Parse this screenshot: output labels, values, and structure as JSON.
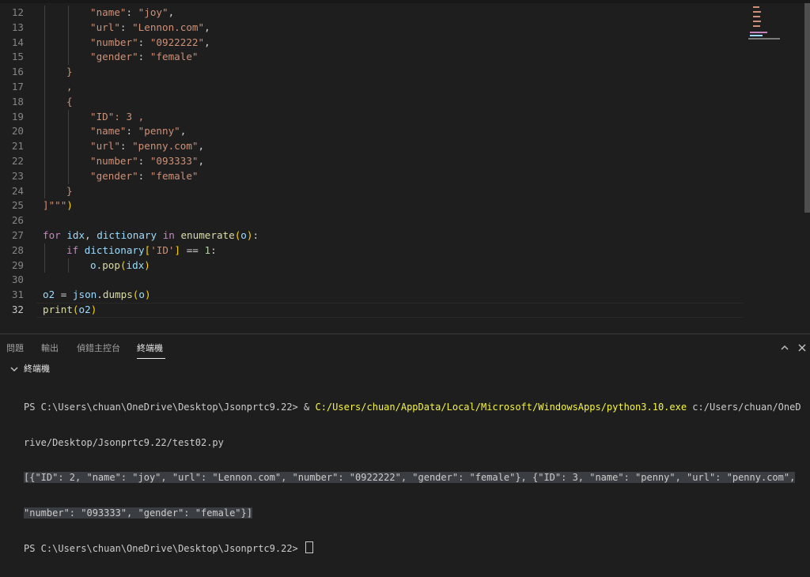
{
  "editor": {
    "lines": [
      {
        "n": "12",
        "indent": 2,
        "tokens": [
          {
            "t": "\"name\"",
            "c": "str"
          },
          {
            "t": ": ",
            "c": "p"
          },
          {
            "t": "\"joy\"",
            "c": "str"
          },
          {
            "t": ",",
            "c": "p"
          }
        ]
      },
      {
        "n": "13",
        "indent": 2,
        "tokens": [
          {
            "t": "\"url\"",
            "c": "str"
          },
          {
            "t": ": ",
            "c": "p"
          },
          {
            "t": "\"Lennon.com\"",
            "c": "str"
          },
          {
            "t": ",",
            "c": "p"
          }
        ]
      },
      {
        "n": "14",
        "indent": 2,
        "tokens": [
          {
            "t": "\"number\"",
            "c": "str"
          },
          {
            "t": ": ",
            "c": "p"
          },
          {
            "t": "\"0922222\"",
            "c": "str"
          },
          {
            "t": ",",
            "c": "p"
          }
        ]
      },
      {
        "n": "15",
        "indent": 2,
        "tokens": [
          {
            "t": "\"gender\"",
            "c": "str"
          },
          {
            "t": ": ",
            "c": "p"
          },
          {
            "t": "\"female\"",
            "c": "str"
          }
        ]
      },
      {
        "n": "16",
        "indent": 1,
        "tokens": [
          {
            "t": "}",
            "c": "str"
          }
        ]
      },
      {
        "n": "17",
        "indent": 1,
        "tokens": [
          {
            "t": ",",
            "c": "str"
          }
        ]
      },
      {
        "n": "18",
        "indent": 1,
        "tokens": [
          {
            "t": "{",
            "c": "str"
          }
        ]
      },
      {
        "n": "19",
        "indent": 2,
        "tokens": [
          {
            "t": "\"ID\"",
            "c": "str"
          },
          {
            "t": ": 3 ,",
            "c": "str"
          }
        ]
      },
      {
        "n": "20",
        "indent": 2,
        "tokens": [
          {
            "t": "\"name\"",
            "c": "str"
          },
          {
            "t": ": ",
            "c": "p"
          },
          {
            "t": "\"penny\"",
            "c": "str"
          },
          {
            "t": ",",
            "c": "p"
          }
        ]
      },
      {
        "n": "21",
        "indent": 2,
        "tokens": [
          {
            "t": "\"url\"",
            "c": "str"
          },
          {
            "t": ": ",
            "c": "p"
          },
          {
            "t": "\"penny.com\"",
            "c": "str"
          },
          {
            "t": ",",
            "c": "p"
          }
        ]
      },
      {
        "n": "22",
        "indent": 2,
        "tokens": [
          {
            "t": "\"number\"",
            "c": "str"
          },
          {
            "t": ": ",
            "c": "p"
          },
          {
            "t": "\"093333\"",
            "c": "str"
          },
          {
            "t": ",",
            "c": "p"
          }
        ]
      },
      {
        "n": "23",
        "indent": 2,
        "tokens": [
          {
            "t": "\"gender\"",
            "c": "str"
          },
          {
            "t": ": ",
            "c": "p"
          },
          {
            "t": "\"female\"",
            "c": "str"
          }
        ]
      },
      {
        "n": "24",
        "indent": 1,
        "tokens": [
          {
            "t": "}",
            "c": "str"
          }
        ]
      },
      {
        "n": "25",
        "indent": 0,
        "tokens": [
          {
            "t": "]\"\"\"",
            "c": "str"
          },
          {
            "t": ")",
            "c": "br1"
          }
        ]
      },
      {
        "n": "26",
        "indent": 0,
        "tokens": []
      },
      {
        "n": "27",
        "indent": 0,
        "tokens": [
          {
            "t": "for",
            "c": "kw"
          },
          {
            "t": " ",
            "c": "p"
          },
          {
            "t": "idx",
            "c": "var"
          },
          {
            "t": ", ",
            "c": "p"
          },
          {
            "t": "dictionary",
            "c": "var"
          },
          {
            "t": " ",
            "c": "p"
          },
          {
            "t": "in",
            "c": "kw"
          },
          {
            "t": " ",
            "c": "p"
          },
          {
            "t": "enumerate",
            "c": "fn"
          },
          {
            "t": "(",
            "c": "br1"
          },
          {
            "t": "o",
            "c": "var"
          },
          {
            "t": ")",
            "c": "br1"
          },
          {
            "t": ":",
            "c": "p"
          }
        ]
      },
      {
        "n": "28",
        "indent": 1,
        "tokens": [
          {
            "t": "if",
            "c": "kw"
          },
          {
            "t": " ",
            "c": "p"
          },
          {
            "t": "dictionary",
            "c": "var"
          },
          {
            "t": "[",
            "c": "br1"
          },
          {
            "t": "'ID'",
            "c": "str"
          },
          {
            "t": "]",
            "c": "br1"
          },
          {
            "t": " == ",
            "c": "p"
          },
          {
            "t": "1",
            "c": "num"
          },
          {
            "t": ":",
            "c": "p"
          }
        ]
      },
      {
        "n": "29",
        "indent": 2,
        "tokens": [
          {
            "t": "o",
            "c": "var"
          },
          {
            "t": ".",
            "c": "p"
          },
          {
            "t": "pop",
            "c": "fn"
          },
          {
            "t": "(",
            "c": "br1"
          },
          {
            "t": "idx",
            "c": "var"
          },
          {
            "t": ")",
            "c": "br1"
          }
        ]
      },
      {
        "n": "30",
        "indent": 0,
        "tokens": []
      },
      {
        "n": "31",
        "indent": 0,
        "tokens": [
          {
            "t": "o2",
            "c": "var"
          },
          {
            "t": " = ",
            "c": "p"
          },
          {
            "t": "json",
            "c": "var"
          },
          {
            "t": ".",
            "c": "p"
          },
          {
            "t": "dumps",
            "c": "fn"
          },
          {
            "t": "(",
            "c": "br1"
          },
          {
            "t": "o",
            "c": "var"
          },
          {
            "t": ")",
            "c": "br1"
          }
        ]
      },
      {
        "n": "32",
        "indent": 0,
        "active": true,
        "tokens": [
          {
            "t": "print",
            "c": "fn"
          },
          {
            "t": "(",
            "c": "br1"
          },
          {
            "t": "o2",
            "c": "var"
          },
          {
            "t": ")",
            "c": "br1"
          }
        ]
      }
    ]
  },
  "panel": {
    "tabs": {
      "problems": "問題",
      "output": "輸出",
      "debug_console": "偵錯主控台",
      "terminal": "終端機"
    },
    "section_title": "終端機"
  },
  "terminal": {
    "line1_prompt": "PS C:\\Users\\chuan\\OneDrive\\Desktop\\Jsonprtc9.22> & ",
    "line1_exe": "C:/Users/chuan/AppData/Local/Microsoft/WindowsApps/python3.10.exe",
    "line1_rest": " c:/Users/chuan/OneD",
    "line2": "rive/Desktop/Jsonprtc9.22/test02.py",
    "line3": "[{\"ID\": 2, \"name\": \"joy\", \"url\": \"Lennon.com\", \"number\": \"0922222\", \"gender\": \"female\"}, {\"ID\": 3, \"name\": \"penny\", \"url\": \"penny.com\",",
    "line4": "\"number\": \"093333\", \"gender\": \"female\"}]",
    "line5": "PS C:\\Users\\chuan\\OneDrive\\Desktop\\Jsonprtc9.22> "
  },
  "icons": {
    "chevron_up": "chevron-up-icon",
    "close": "close-icon",
    "chevron_down": "chevron-down-icon"
  },
  "colors": {
    "background": "#1e1e1e",
    "string": "#ce9178",
    "keyword": "#c586c0",
    "variable": "#9cdcfe",
    "function": "#dcdcaa",
    "number": "#b5cea8",
    "bracket": "#ffd700",
    "terminal_yellow": "#f5f543"
  }
}
